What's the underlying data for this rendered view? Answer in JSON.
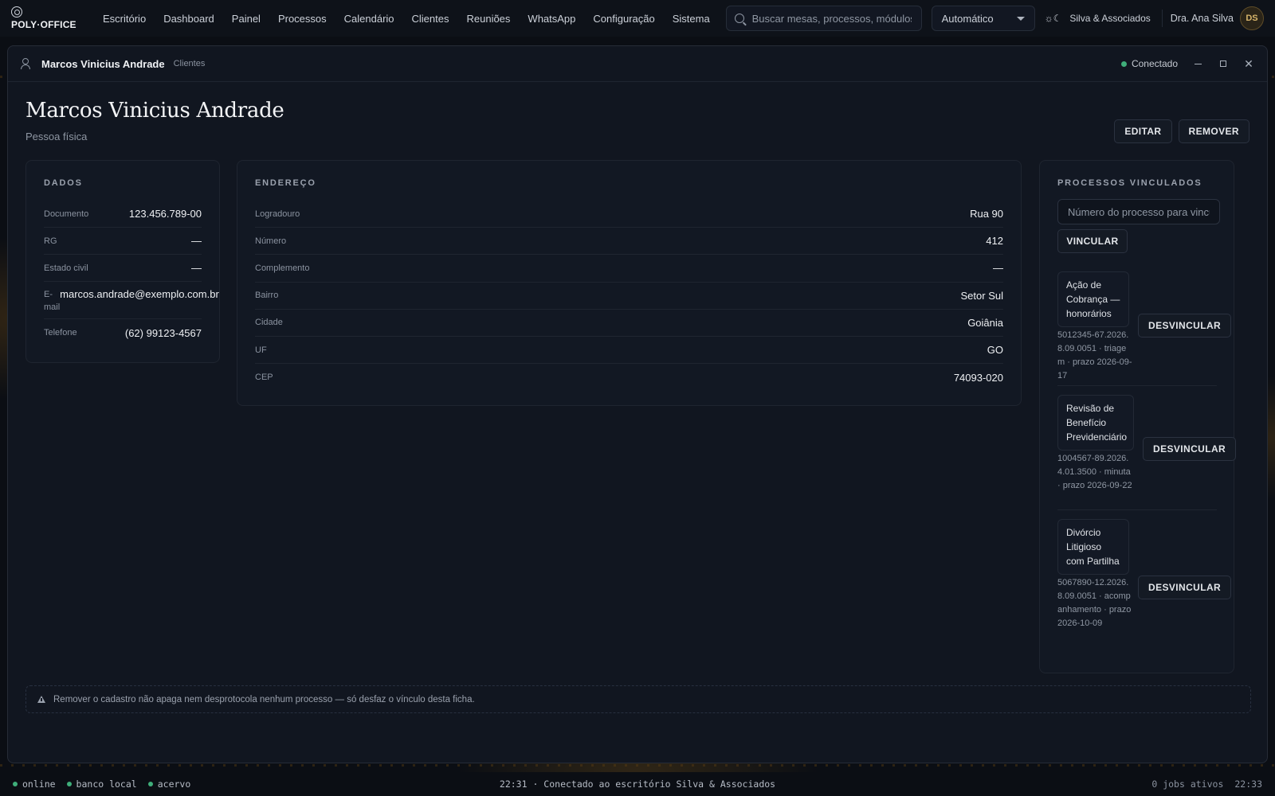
{
  "app": {
    "logo": "POLY·OFFICE",
    "nav": [
      "Escritório",
      "Dashboard",
      "Painel",
      "Processos",
      "Calendário",
      "Clientes",
      "Reuniões",
      "WhatsApp",
      "Configuração",
      "Sistema"
    ],
    "search_placeholder": "Buscar mesas, processos, módulos",
    "mode": "Automático",
    "theme_toggle": "☼☾",
    "office": "Silva & Associados",
    "user_name": "Dra. Ana Silva",
    "user_initials": "DS"
  },
  "window": {
    "title": "Marcos Vinicius Andrade",
    "subtitle": "Clientes",
    "status": "Conectado"
  },
  "header": {
    "name": "Marcos Vinicius Andrade",
    "type": "Pessoa física",
    "edit": "EDITAR",
    "remove": "REMOVER"
  },
  "dados": {
    "title": "DADOS",
    "rows": [
      {
        "label": "Documento",
        "value": "123.456.789-00"
      },
      {
        "label": "RG",
        "value": "—"
      },
      {
        "label": "Estado civil",
        "value": "—"
      },
      {
        "label": "E-mail",
        "value": "marcos.andrade@exemplo.com.br"
      },
      {
        "label": "Telefone",
        "value": "(62) 99123-4567"
      }
    ]
  },
  "endereco": {
    "title": "ENDEREÇO",
    "rows": [
      {
        "label": "Logradouro",
        "value": "Rua 90"
      },
      {
        "label": "Número",
        "value": "412"
      },
      {
        "label": "Complemento",
        "value": "—"
      },
      {
        "label": "Bairro",
        "value": "Setor Sul"
      },
      {
        "label": "Cidade",
        "value": "Goiânia"
      },
      {
        "label": "UF",
        "value": "GO"
      },
      {
        "label": "CEP",
        "value": "74093-020"
      }
    ]
  },
  "processos": {
    "title": "PROCESSOS VINCULADOS",
    "placeholder": "Número do processo para vincular",
    "link_button": "VINCULAR",
    "unlink_button": "DESVINCULAR",
    "items": [
      {
        "name": "Ação de Cobrança — honorários",
        "meta": "5012345-67.2026.8.09.0051 · triagem · prazo 2026-09-17"
      },
      {
        "name": "Revisão de Benefício Previdenciário",
        "meta": "1004567-89.2026.4.01.3500 · minuta · prazo 2026-09-22"
      },
      {
        "name": "Divórcio Litigioso com Partilha",
        "meta": "5067890-12.2026.8.09.0051 · acompanhamento · prazo 2026-10-09"
      }
    ]
  },
  "warning": "Remover o cadastro não apaga nem desprotocola nenhum processo — só desfaz o vínculo desta ficha.",
  "statusbar": {
    "items": [
      "online",
      "banco local",
      "acervo"
    ],
    "center": "22:31 · Conectado ao escritório Silva & Associados",
    "jobs": "0 jobs ativos",
    "time": "22:33"
  },
  "colors": {
    "accent": "#d6b46a",
    "ok": "#3fae7a",
    "bg": "#111620"
  }
}
